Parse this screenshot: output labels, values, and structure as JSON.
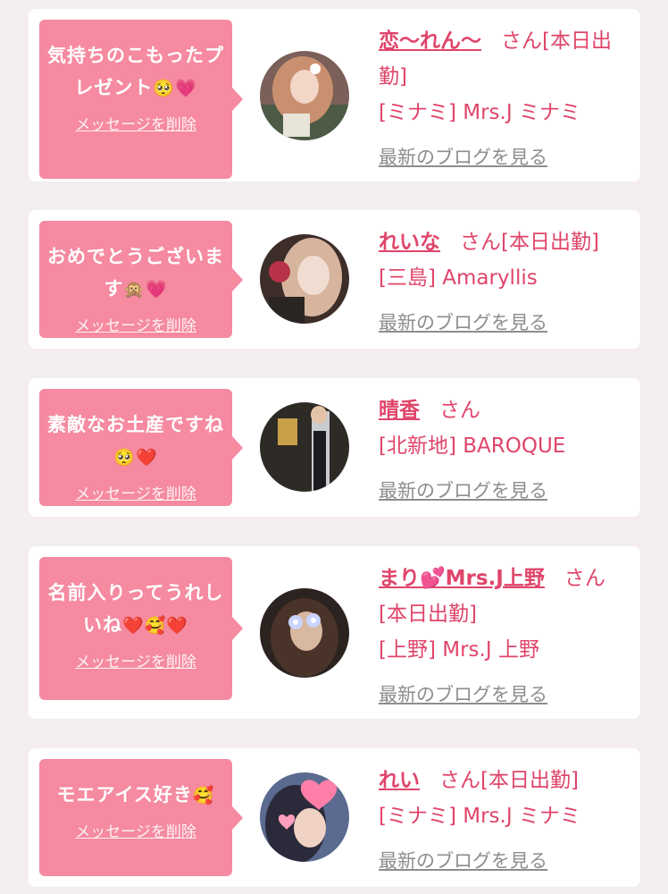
{
  "theme": {
    "accent": "#f58aa0",
    "name_color": "#e0456a",
    "link_gray": "#8d8d8d"
  },
  "cards": [
    {
      "message": "気持ちのこもったプレゼント",
      "message_emoji": "🥺💗",
      "delete_label": "メッセージを削除",
      "cast_name": "恋〜れん〜",
      "honorific": "さん",
      "work_status": "[本日出勤]",
      "shop": "[ミナミ] Mrs.J ミナミ",
      "blog_label": "最新のブログを見る",
      "avatar_icon": "cast-photo-icon"
    },
    {
      "message": "おめでとうございます",
      "message_emoji": "🙊💗",
      "delete_label": "メッセージを削除",
      "cast_name": "れいな",
      "honorific": "さん",
      "work_status": "[本日出勤]",
      "shop": "[三島] Amaryllis",
      "blog_label": "最新のブログを見る",
      "avatar_icon": "cast-photo-icon"
    },
    {
      "message": "素敵なお土産ですね",
      "message_emoji": "🥺❤️",
      "delete_label": "メッセージを削除",
      "cast_name": "晴香",
      "honorific": "さん",
      "work_status": "",
      "shop": "[北新地] BAROQUE",
      "blog_label": "最新のブログを見る",
      "avatar_icon": "cast-photo-icon"
    },
    {
      "message": "名前入りってうれしいね",
      "message_emoji": "❤️🥰❤️",
      "delete_label": "メッセージを削除",
      "cast_name": "まり💕Mrs.J上野",
      "honorific": "さん",
      "work_status": "[本日出勤]",
      "shop": "[上野] Mrs.J 上野",
      "blog_label": "最新のブログを見る",
      "avatar_icon": "cast-photo-icon"
    },
    {
      "message": "モエアイス好き",
      "message_emoji": "🥰",
      "delete_label": "メッセージを削除",
      "cast_name": "れい",
      "honorific": "さん",
      "work_status": "[本日出勤]",
      "shop": "[ミナミ] Mrs.J ミナミ",
      "blog_label": "最新のブログを見る",
      "avatar_icon": "cast-photo-icon"
    }
  ]
}
